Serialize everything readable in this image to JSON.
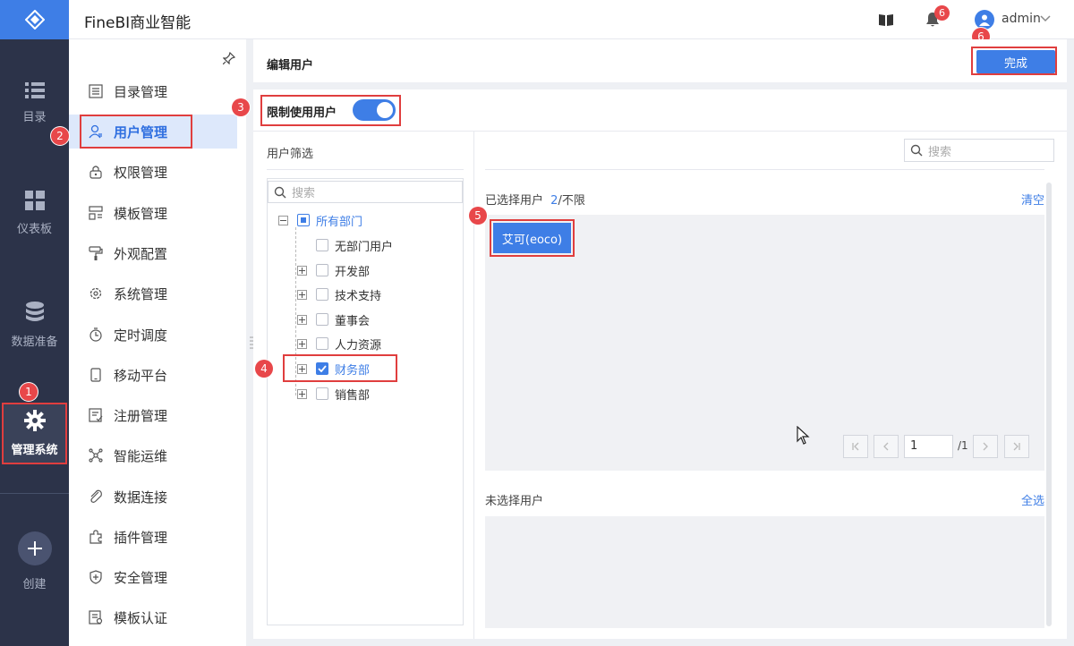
{
  "app": {
    "title": "FineBI商业智能"
  },
  "topbar": {
    "notification_count": "6",
    "user": "admin"
  },
  "rail": {
    "items": [
      {
        "label": "目录",
        "icon": "list-icon"
      },
      {
        "label": "仪表板",
        "icon": "dashboard-icon"
      },
      {
        "label": "数据准备",
        "icon": "database-icon"
      },
      {
        "label": "管理系统",
        "icon": "gear-icon",
        "active": true
      },
      {
        "label": "创建",
        "icon": "plus-icon"
      }
    ]
  },
  "subnav": {
    "items": [
      {
        "label": "目录管理"
      },
      {
        "label": "用户管理",
        "active": true
      },
      {
        "label": "权限管理"
      },
      {
        "label": "模板管理"
      },
      {
        "label": "外观配置"
      },
      {
        "label": "系统管理"
      },
      {
        "label": "定时调度"
      },
      {
        "label": "移动平台"
      },
      {
        "label": "注册管理"
      },
      {
        "label": "智能运维"
      },
      {
        "label": "数据连接"
      },
      {
        "label": "插件管理"
      },
      {
        "label": "安全管理"
      },
      {
        "label": "模板认证"
      }
    ]
  },
  "main": {
    "title": "编辑用户",
    "done_label": "完成",
    "restrict_label": "限制使用用户",
    "restrict_enabled": true,
    "filter_title": "用户筛选",
    "search_placeholder": "搜索",
    "tree": {
      "root": "所有部门",
      "children": [
        {
          "label": "无部门用户",
          "checked": false
        },
        {
          "label": "开发部",
          "checked": false
        },
        {
          "label": "技术支持",
          "checked": false
        },
        {
          "label": "董事会",
          "checked": false
        },
        {
          "label": "人力资源",
          "checked": false
        },
        {
          "label": "财务部",
          "checked": true
        },
        {
          "label": "销售部",
          "checked": false
        }
      ]
    },
    "selected": {
      "label": "已选择用户",
      "count": "2",
      "limit": "/不限",
      "clear": "清空",
      "users": [
        "艾可(eoco)"
      ]
    },
    "pagination": {
      "page": "1",
      "total": "/1"
    },
    "unselected": {
      "label": "未选择用户",
      "select_all": "全选"
    }
  },
  "callouts": [
    "1",
    "2",
    "3",
    "4",
    "5",
    "6"
  ],
  "colors": {
    "accent": "#3e7ee6",
    "rail_bg": "#2c3349",
    "highlight": "#e03e3e"
  }
}
